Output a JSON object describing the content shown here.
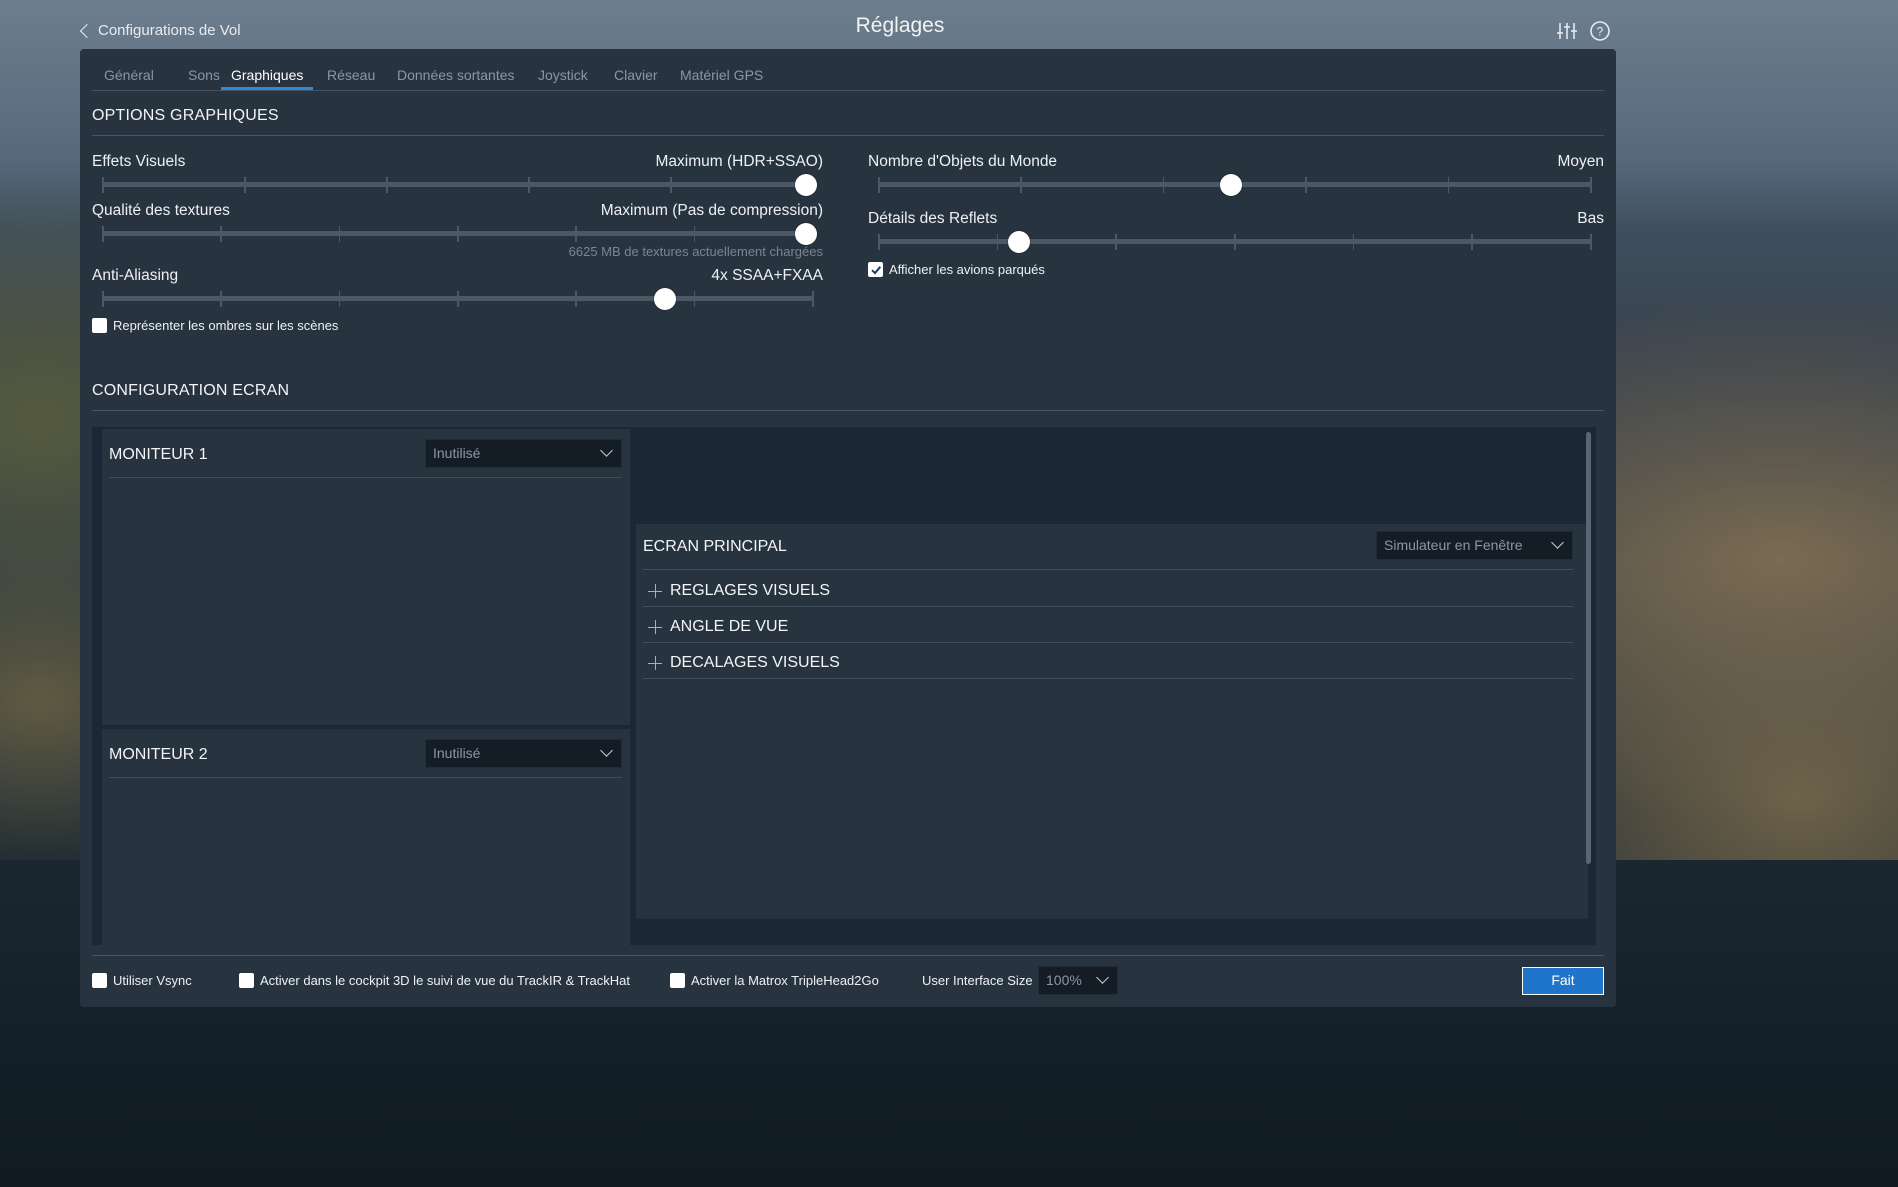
{
  "header": {
    "back_label": "Configurations de Vol",
    "title": "Réglages"
  },
  "tabs": [
    {
      "label": "Général",
      "active": false
    },
    {
      "label": "Sons",
      "active": false
    },
    {
      "label": "Graphiques",
      "active": true
    },
    {
      "label": "Réseau",
      "active": false
    },
    {
      "label": "Données sortantes",
      "active": false
    },
    {
      "label": "Joystick",
      "active": false
    },
    {
      "label": "Clavier",
      "active": false
    },
    {
      "label": "Matériel GPS",
      "active": false
    }
  ],
  "graphics": {
    "title": "OPTIONS GRAPHIQUES",
    "visual_effects": {
      "label": "Effets Visuels",
      "value": "Maximum (HDR+SSAO)",
      "level": 1.0
    },
    "texture_quality": {
      "label": "Qualité des textures",
      "value": "Maximum (Pas de compression)",
      "level": 1.0,
      "note": "6625 MB de textures actuellement chargées"
    },
    "anti_aliasing": {
      "label": "Anti-Aliasing",
      "value": "4x SSAA+FXAA",
      "level": 0.8
    },
    "shadows_checkbox": {
      "label": "Représenter les ombres sur les scènes",
      "checked": false
    },
    "world_objects": {
      "label": "Nombre d'Objets du Monde",
      "value": "Moyen",
      "level": 0.5
    },
    "reflections": {
      "label": "Détails des Reflets",
      "value": "Bas",
      "level": 0.2
    },
    "parked_aircraft_checkbox": {
      "label": "Afficher les avions parqués",
      "checked": true
    }
  },
  "screen": {
    "title": "CONFIGURATION ECRAN",
    "monitor1": {
      "title": "MONITEUR 1",
      "selected": "Inutilisé"
    },
    "monitor2": {
      "title": "MONITEUR 2",
      "selected": "Inutilisé"
    },
    "main_screen": {
      "title": "ECRAN PRINCIPAL",
      "selected": "Simulateur en Fenêtre",
      "sections": [
        "REGLAGES VISUELS",
        "ANGLE DE VUE",
        "DECALAGES VISUELS"
      ]
    }
  },
  "footer": {
    "vsync": {
      "label": "Utiliser Vsync",
      "checked": false
    },
    "trackir": {
      "label": "Activer dans le cockpit 3D le suivi de vue du TrackIR & TrackHat",
      "checked": false
    },
    "matrox": {
      "label": "Activer la Matrox TripleHead2Go",
      "checked": false
    },
    "ui_size_label": "User Interface Size",
    "ui_size_value": "100%",
    "done_label": "Fait"
  }
}
